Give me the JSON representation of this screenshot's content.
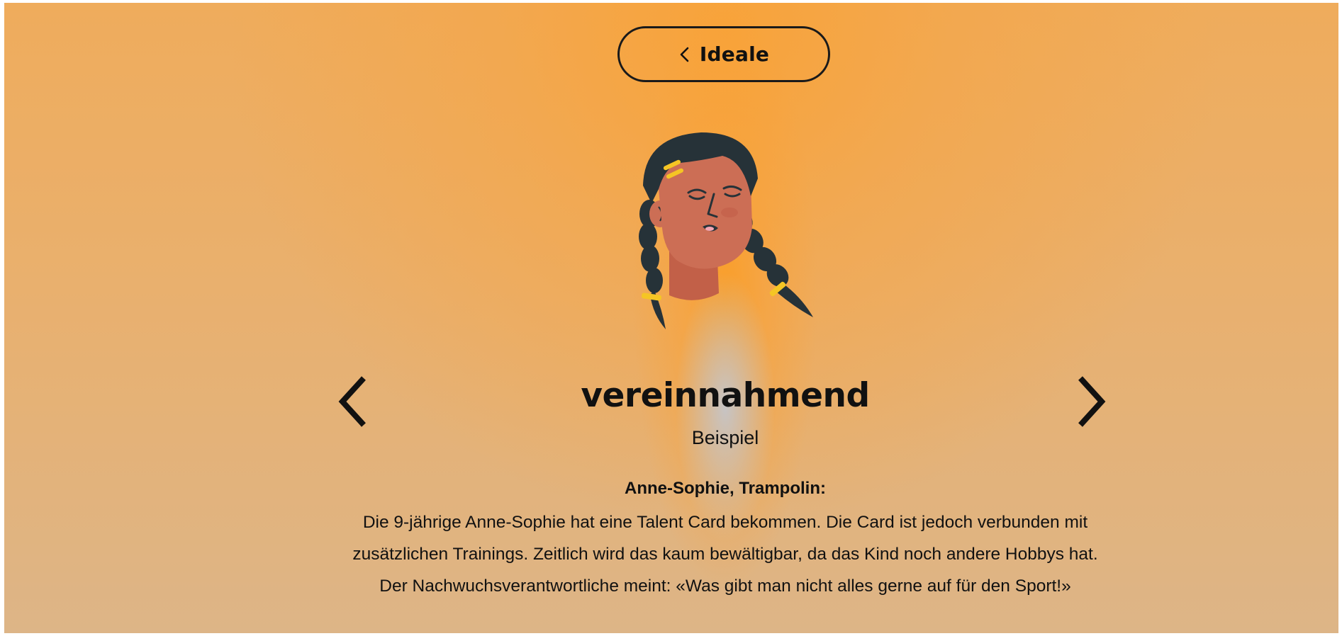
{
  "nav": {
    "back_label": "Ideale"
  },
  "card": {
    "title": "vereinnahmend",
    "subtitle": "Beispiel",
    "example_heading": "Anne-Sophie, Trampolin:",
    "example_text": "Die 9-jährige Anne-Sophie hat eine Talent Card bekommen. Die Card ist jedoch verbunden mit zusätzlichen Trainings. Zeitlich wird das kaum bewältigbar, da das Kind noch andere Hobbys hat. Der Nachwuchsverantwortliche meint: «Was gibt man nicht alles gerne auf für den Sport!»"
  },
  "icons": {
    "back": "chevron-left-icon",
    "prev": "chevron-left-icon",
    "next": "chevron-right-icon",
    "avatar": "girl-with-braids-illustration"
  },
  "colors": {
    "background_accent": "#f8a33a",
    "text": "#111111",
    "hair": "#263238",
    "skin": "#cc6e55",
    "hair_clip": "#f5c524"
  }
}
